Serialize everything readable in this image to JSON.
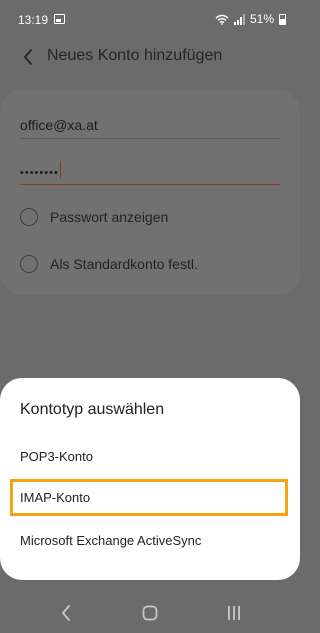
{
  "status_bar": {
    "time": "13:19",
    "battery": "51%",
    "icons": [
      "image-icon",
      "wifi-icon",
      "signal-icon",
      "battery-icon"
    ]
  },
  "app_bar": {
    "back_icon": "chevron-left-icon",
    "title": "Neues Konto hinzufügen"
  },
  "form": {
    "email_value": "office@xa.at",
    "password_value": "••••••••",
    "show_password_label": "Passwort anzeigen",
    "default_account_label": "Als Standardkonto festl.",
    "accent_color": "#8a3a2c"
  },
  "sheet": {
    "title": "Kontotyp auswählen",
    "options": [
      "POP3-Konto",
      "IMAP-Konto",
      "Microsoft Exchange ActiveSync"
    ],
    "highlighted_option": "IMAP-Konto",
    "highlight_color": "#f5a40f"
  },
  "nav_bar": {
    "icons": [
      "back-icon",
      "home-icon",
      "recent-apps-icon"
    ]
  }
}
